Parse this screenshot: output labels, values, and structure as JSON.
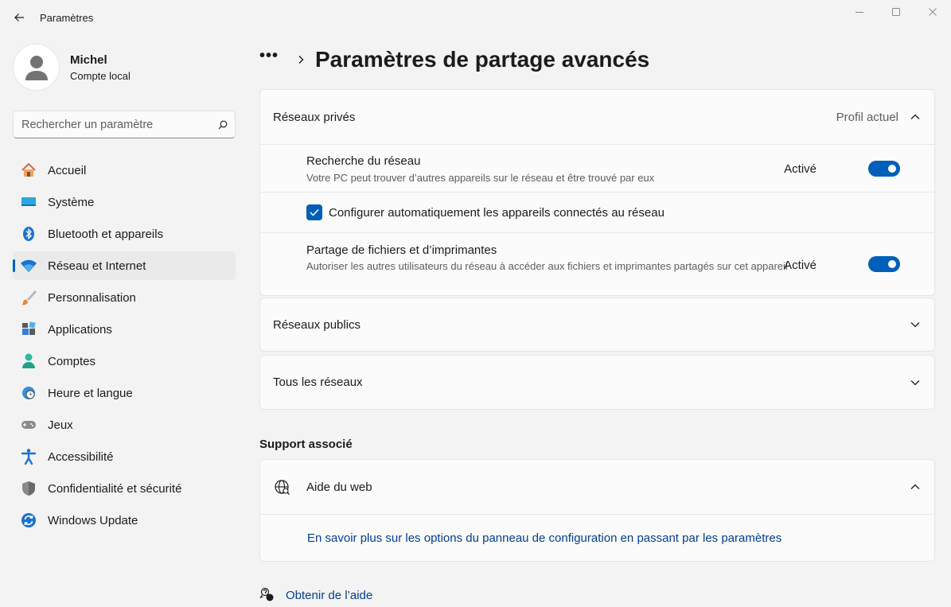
{
  "window": {
    "title": "Paramètres"
  },
  "profile": {
    "name": "Michel",
    "account_type": "Compte local"
  },
  "search": {
    "placeholder": "Rechercher un paramètre"
  },
  "sidebar": {
    "items": [
      {
        "label": "Accueil",
        "icon": "home-icon"
      },
      {
        "label": "Système",
        "icon": "system-icon"
      },
      {
        "label": "Bluetooth et appareils",
        "icon": "bluetooth-icon"
      },
      {
        "label": "Réseau et Internet",
        "icon": "wifi-icon",
        "active": true
      },
      {
        "label": "Personnalisation",
        "icon": "brush-icon"
      },
      {
        "label": "Applications",
        "icon": "apps-icon"
      },
      {
        "label": "Comptes",
        "icon": "person-icon"
      },
      {
        "label": "Heure et langue",
        "icon": "clock-globe-icon"
      },
      {
        "label": "Jeux",
        "icon": "gamepad-icon"
      },
      {
        "label": "Accessibilité",
        "icon": "accessibility-icon"
      },
      {
        "label": "Confidentialité et sécurité",
        "icon": "shield-icon"
      },
      {
        "label": "Windows Update",
        "icon": "update-icon"
      }
    ]
  },
  "breadcrumb": {
    "more": "•••",
    "title": "Paramètres de partage avancés"
  },
  "private_networks": {
    "label": "Réseaux privés",
    "status": "Profil actuel",
    "network_discovery": {
      "title": "Recherche du réseau",
      "description": "Votre PC peut trouver d’autres appareils sur le réseau et être trouvé par eux",
      "state": "Activé"
    },
    "auto_setup": {
      "label": "Configurer automatiquement les appareils connectés au réseau",
      "checked": true
    },
    "file_sharing": {
      "title": "Partage de fichiers et d’imprimantes",
      "description": "Autoriser les autres utilisateurs du réseau à accéder aux fichiers et imprimantes partagés sur cet appareil",
      "state": "Activé"
    }
  },
  "public_networks": {
    "label": "Réseaux publics"
  },
  "all_networks": {
    "label": "Tous les réseaux"
  },
  "support": {
    "section_title": "Support associé",
    "web_help": "Aide du web",
    "link": "En savoir plus sur les options du panneau de configuration en passant par les paramètres"
  },
  "get_help": {
    "label": "Obtenir de l’aide"
  },
  "colors": {
    "accent": "#005fb8",
    "link": "#003e92",
    "background": "#f3f3f3",
    "card": "#fbfbfb"
  }
}
